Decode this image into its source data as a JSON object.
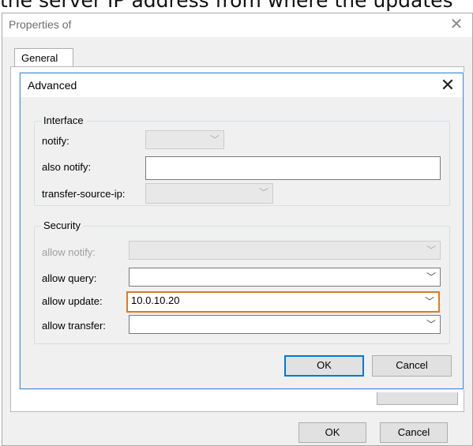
{
  "caption": "the server IP address from where the updates",
  "outer_window": {
    "title": "Properties of",
    "close_glyph": "✕",
    "tab_label": "General",
    "ok_label": "OK",
    "cancel_label": "Cancel"
  },
  "advanced": {
    "title": "Advanced",
    "close_glyph": "✕",
    "interface_group": {
      "label": "Interface",
      "notify_label": "notify:",
      "notify_value": "",
      "also_notify_label": "also notify:",
      "also_notify_value": "",
      "transfer_source_label": "transfer-source-ip:",
      "transfer_source_value": ""
    },
    "security_group": {
      "label": "Security",
      "allow_notify_label": "allow notify:",
      "allow_notify_value": "",
      "allow_query_label": "allow query:",
      "allow_query_value": "",
      "allow_update_label": "allow update:",
      "allow_update_value": "10.0.10.20",
      "allow_transfer_label": "allow transfer:",
      "allow_transfer_value": ""
    },
    "ok_label": "OK",
    "cancel_label": "Cancel",
    "dropdown_glyph": "﹀"
  },
  "colors": {
    "focus_outline": "#e07a1f",
    "default_button_border": "#0078d7",
    "dialog_border": "#4a8fd6"
  }
}
